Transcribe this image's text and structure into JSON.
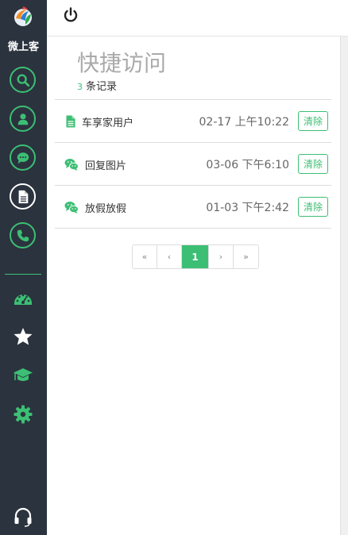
{
  "sidebar": {
    "brand": "微上客",
    "nav": [
      "search-icon",
      "user-icon",
      "chat-icon",
      "document-icon",
      "phone-icon"
    ],
    "tools": [
      "dashboard-icon",
      "star-icon",
      "graduation-cap-icon",
      "gear-icon"
    ],
    "bottom": "headset-icon",
    "accent_color": "#3cbf74",
    "background_color": "#2b333e"
  },
  "header": {
    "power_icon": "power-icon"
  },
  "main": {
    "title": "快捷访问",
    "count": "3",
    "count_label": "条记录",
    "rows": [
      {
        "icon": "document-icon",
        "name": "车享家用户",
        "time": "02-17 上午10:22",
        "action": "清除"
      },
      {
        "icon": "wechat-icon",
        "name": "回复图片",
        "time": "03-06 下午6:10",
        "action": "清除"
      },
      {
        "icon": "wechat-icon",
        "name": "放假放假",
        "time": "01-03 下午2:42",
        "action": "清除"
      }
    ],
    "pagination": {
      "first": "«",
      "prev": "‹",
      "current": "1",
      "next": "›",
      "last": "»"
    }
  }
}
